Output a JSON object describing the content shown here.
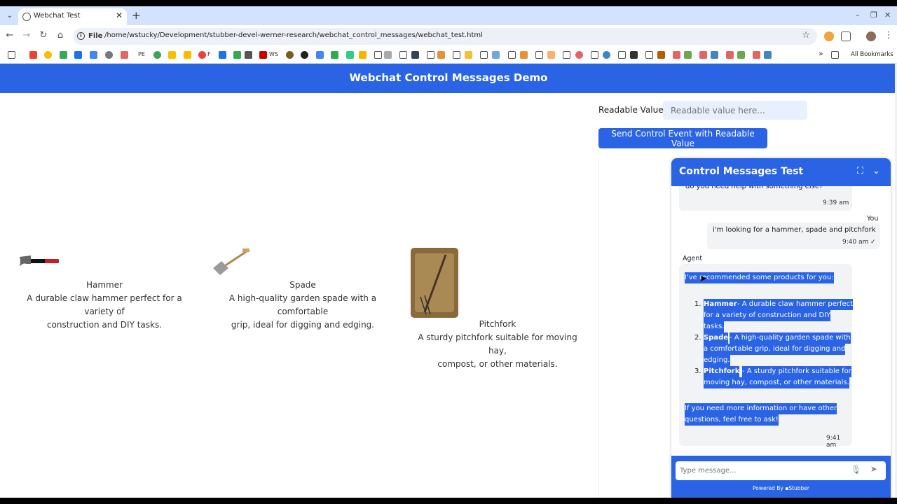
{
  "browser": {
    "tab_title": "Webchat Test",
    "new_tab": "+",
    "url_chip": "File",
    "url": "/home/wstucky/Development/stubber-devel-werner-research/webchat_control_messages/webchat_test.html",
    "all_bookmarks": "All Bookmarks",
    "bookmarks": [
      {
        "text": "PE"
      },
      {
        "text": "F"
      },
      {
        "text": "WS"
      }
    ]
  },
  "page": {
    "title": "Webchat Control Messages Demo",
    "readable_label": "Readable Value :",
    "readable_placeholder": "Readable value here...",
    "send_button": "Send Control Event with Readable Value"
  },
  "products": [
    {
      "name": "Hammer",
      "desc1": "A durable claw hammer perfect for a variety of",
      "desc2": "construction and DIY tasks."
    },
    {
      "name": "Spade",
      "desc1": "A high-quality garden spade with a comfortable",
      "desc2": "grip, ideal for digging and edging."
    },
    {
      "name": "Pitchfork",
      "desc1": "A sturdy pitchfork suitable for moving hay,",
      "desc2": "compost, or other materials."
    }
  ],
  "chat": {
    "title": "Control Messages Test",
    "partial_msg": "do you need help with something else?",
    "partial_time": "9:39 am",
    "user_sender": "You",
    "user_msg": "i'm looking for a hammer, spade and pitchfork",
    "user_time": "9:40 am",
    "agent_sender": "Agent",
    "agent_intro": "I've recommended some products for you:",
    "items": [
      {
        "num": "1.",
        "name": "Hammer",
        "lines": [
          "- A durable claw hammer perfect",
          "for a variety of construction and DIY",
          "tasks."
        ]
      },
      {
        "num": "2.",
        "name": "Spade",
        "lines": [
          "- A high-quality garden spade with",
          "a comfortable grip, ideal for digging and",
          "edging."
        ]
      },
      {
        "num": "3.",
        "name": "Pitchfork",
        "lines": [
          "- A sturdy pitchfork suitable for",
          "moving hay, compost, or other materials."
        ]
      }
    ],
    "outro1": "If you need more information or have other",
    "outro2": "questions, feel free to ask!",
    "agent_time": "9:41 am",
    "input_placeholder": "Type message...",
    "powered_by": "Powered By",
    "brand": "Stubber"
  }
}
